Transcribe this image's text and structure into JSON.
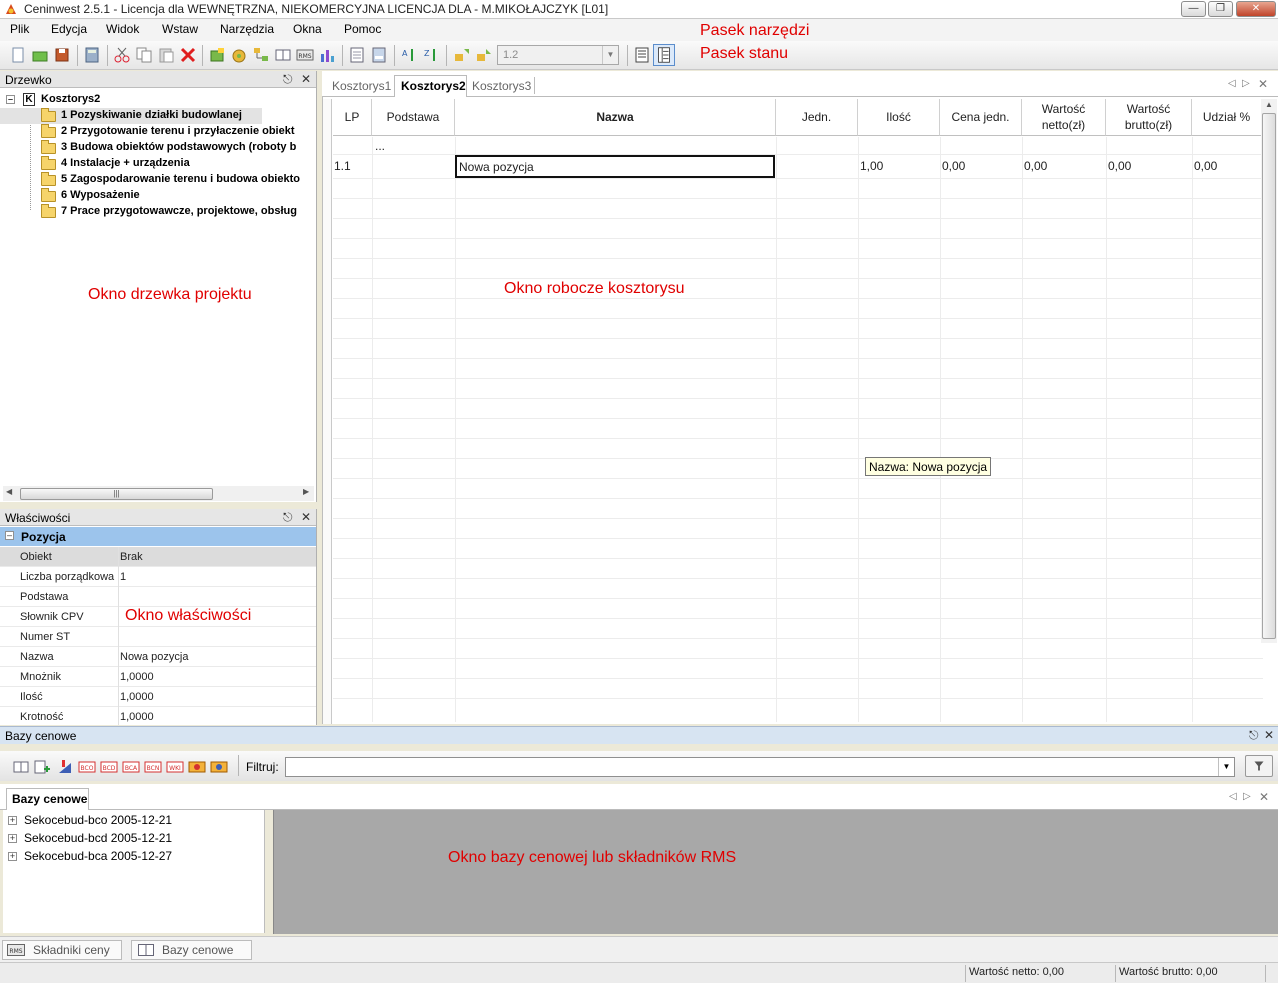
{
  "window": {
    "title": "Ceninwest 2.5.1 - Licencja dla WEWNĘTRZNA, NIEKOMERCYJNA LICENCJA DLA - M.MIKOŁAJCZYK [L01]"
  },
  "menu": [
    "Plik",
    "Edycja",
    "Widok",
    "Wstaw",
    "Narzędzia",
    "Okna",
    "Pomoc"
  ],
  "toolbar": {
    "zoom_value": "1.2"
  },
  "annotations": {
    "toolbar": "Pasek narzędzi",
    "statusbar": "Pasek stanu",
    "tree": "Okno drzewka projektu",
    "workspace": "Okno robocze kosztorysu",
    "properties": "Okno właściwości",
    "pricebase": "Okno bazy cenowej lub składników RMS"
  },
  "tree": {
    "title": "Drzewko",
    "root_letter": "K",
    "root": "Kosztorys2",
    "items": [
      "1 Pozyskiwanie działki budowlanej",
      "2 Przygotowanie terenu i przyłaczenie obiekt",
      "3 Budowa obiektów podstawowych (roboty b",
      "4 Instalacje + urządzenia",
      "5 Zagospodarowanie terenu i budowa obiekto",
      "6 Wyposażenie",
      "7 Prace przygotowawcze, projektowe, obsług"
    ]
  },
  "properties": {
    "title": "Właściwości",
    "section": "Pozycja",
    "rows": [
      {
        "k": "Obiekt",
        "v": "Brak"
      },
      {
        "k": "Liczba porządkowa",
        "v": "1"
      },
      {
        "k": "Podstawa",
        "v": ""
      },
      {
        "k": "Słownik CPV",
        "v": ""
      },
      {
        "k": "Numer ST",
        "v": ""
      },
      {
        "k": "Nazwa",
        "v": "Nowa pozycja"
      },
      {
        "k": "Mnożnik",
        "v": "1,0000"
      },
      {
        "k": "Ilość",
        "v": "1,0000"
      },
      {
        "k": "Krotność",
        "v": "1,0000"
      }
    ]
  },
  "doc_tabs": [
    "Kosztorys1",
    "Kosztorys2",
    "Kosztorys3"
  ],
  "grid": {
    "headers": {
      "lp": "LP",
      "podstawa": "Podstawa",
      "nazwa": "Nazwa",
      "jedn": "Jedn.",
      "ilosc": "Ilość",
      "cena": "Cena jedn.",
      "netto1": "Wartość",
      "netto2": "netto(zł)",
      "brutto1": "Wartość",
      "brutto2": "brutto(zł)",
      "udzial": "Udział %"
    },
    "ellipsis": "...",
    "row": {
      "lp": "1.1",
      "nazwa": "Nowa pozycja",
      "ilosc": "1,00",
      "cena": "0,00",
      "netto": "0,00",
      "brutto": "0,00",
      "udzial": "0,00"
    },
    "tooltip": "Nazwa: Nowa pozycja"
  },
  "pricebases": {
    "title": "Bazy cenowe",
    "filter_label": "Filtruj:",
    "filter_value": "",
    "tab": "Bazy cenowe",
    "items": [
      "Sekocebud-bco 2005-12-21",
      "Sekocebud-bcd 2005-12-21",
      "Sekocebud-bca 2005-12-27"
    ]
  },
  "bottom_tabs": [
    "Składniki ceny",
    "Bazy cenowe"
  ],
  "status": {
    "netto": "Wartość netto: 0,00",
    "brutto": "Wartość brutto: 0,00"
  },
  "colors": {
    "selection": "#9cc4ec",
    "annotation": "#e00000",
    "folder": "#f6d46a"
  }
}
